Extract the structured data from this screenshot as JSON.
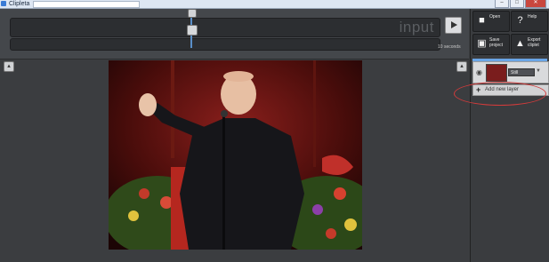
{
  "window": {
    "title": "Clipleta",
    "buttons": [
      "–",
      "□",
      "✕"
    ]
  },
  "timeline": {
    "input_label": "input",
    "duration": "10 seconds",
    "play_icon": "play-icon"
  },
  "toolbar": {
    "open_label": "Open",
    "help_label": "Help",
    "save_label": "Save project",
    "export_label": "Export cliplet",
    "open_icon": "folder-icon",
    "help_icon": "question-icon",
    "save_icon": "disk-icon",
    "export_icon": "export-icon"
  },
  "layers": {
    "items": [
      {
        "name": "Still",
        "visible_icon": "eye-icon"
      }
    ],
    "add_label": "Add new layer"
  },
  "colors": {
    "accent": "#6aa5e6",
    "annotation": "#d23b3b"
  }
}
